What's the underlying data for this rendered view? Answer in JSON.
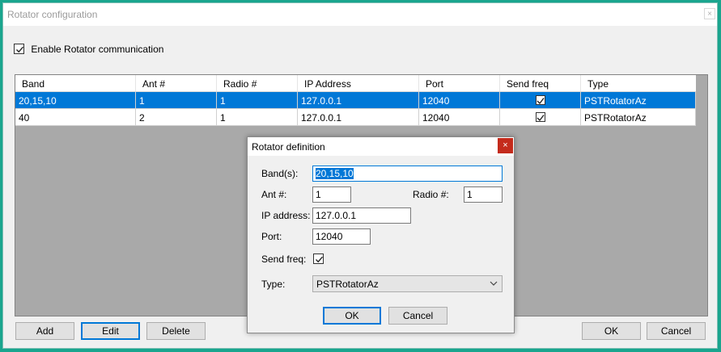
{
  "window": {
    "title": "Rotator configuration",
    "close_glyph": "×"
  },
  "enable": {
    "label": "Enable Rotator communication",
    "checked": true
  },
  "table": {
    "columns": [
      "Band",
      "Ant #",
      "Radio #",
      "IP Address",
      "Port",
      "Send freq",
      "Type"
    ],
    "rows": [
      {
        "band": "20,15,10",
        "ant": "1",
        "radio": "1",
        "ip": "127.0.0.1",
        "port": "12040",
        "send_freq": true,
        "type": "PSTRotatorAz",
        "selected": true
      },
      {
        "band": "40",
        "ant": "2",
        "radio": "1",
        "ip": "127.0.0.1",
        "port": "12040",
        "send_freq": true,
        "type": "PSTRotatorAz",
        "selected": false
      }
    ]
  },
  "buttons": {
    "add": "Add",
    "edit": "Edit",
    "delete": "Delete",
    "ok": "OK",
    "cancel": "Cancel"
  },
  "dialog": {
    "title": "Rotator definition",
    "close_glyph": "×",
    "bands_label": "Band(s):",
    "bands_value": "20,15,10",
    "ant_label": "Ant #:",
    "ant_value": "1",
    "radio_label": "Radio #:",
    "radio_value": "1",
    "ip_label": "IP address:",
    "ip_value": "127.0.0.1",
    "port_label": "Port:",
    "port_value": "12040",
    "sendfreq_label": "Send freq:",
    "sendfreq_checked": true,
    "type_label": "Type:",
    "type_value": "PSTRotatorAz",
    "ok": "OK",
    "cancel": "Cancel"
  }
}
